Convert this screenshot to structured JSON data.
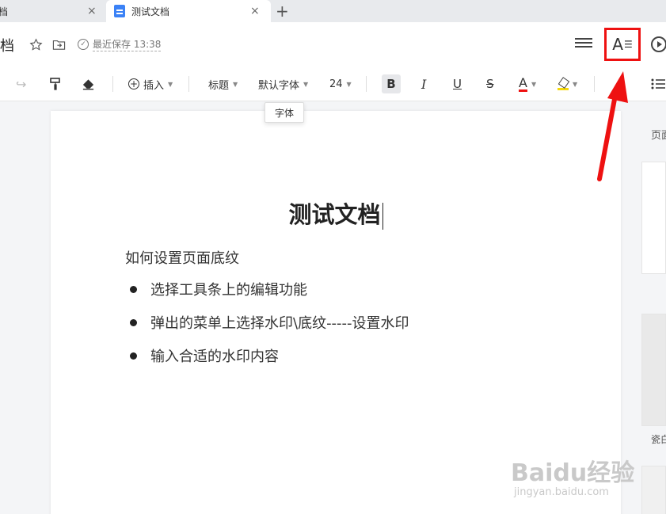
{
  "tabs": [
    {
      "label": "档",
      "close": "×"
    },
    {
      "label": "测试文档",
      "close": "×"
    }
  ],
  "tab_add": "+",
  "header": {
    "doc_title": "档",
    "save_status": "最近保存 13:38",
    "font_panel_label": "A",
    "font_panel_lines": "☰"
  },
  "toolbar": {
    "insert": "插入",
    "heading": "标题",
    "font_name": "默认字体",
    "font_size": "24",
    "bold": "B",
    "italic": "I",
    "underline": "U",
    "strike": "S",
    "font_color": "A",
    "tooltip": "字体"
  },
  "document": {
    "title": "测试文档",
    "paragraph": "如何设置页面底纹",
    "bullets": [
      "选择工具条上的编辑功能",
      "弹出的菜单上选择水印\\底纹-----设置水印",
      "输入合适的水印内容"
    ]
  },
  "sidebar": {
    "label": "页面",
    "caption": "瓷白"
  },
  "watermark": {
    "logo": "Baidu经验",
    "sub": "jingyan.baidu.com"
  },
  "colors": {
    "highlight_box": "#e11111",
    "accent_blue": "#3b82f6",
    "highlight_yellow": "#f5d90a"
  }
}
